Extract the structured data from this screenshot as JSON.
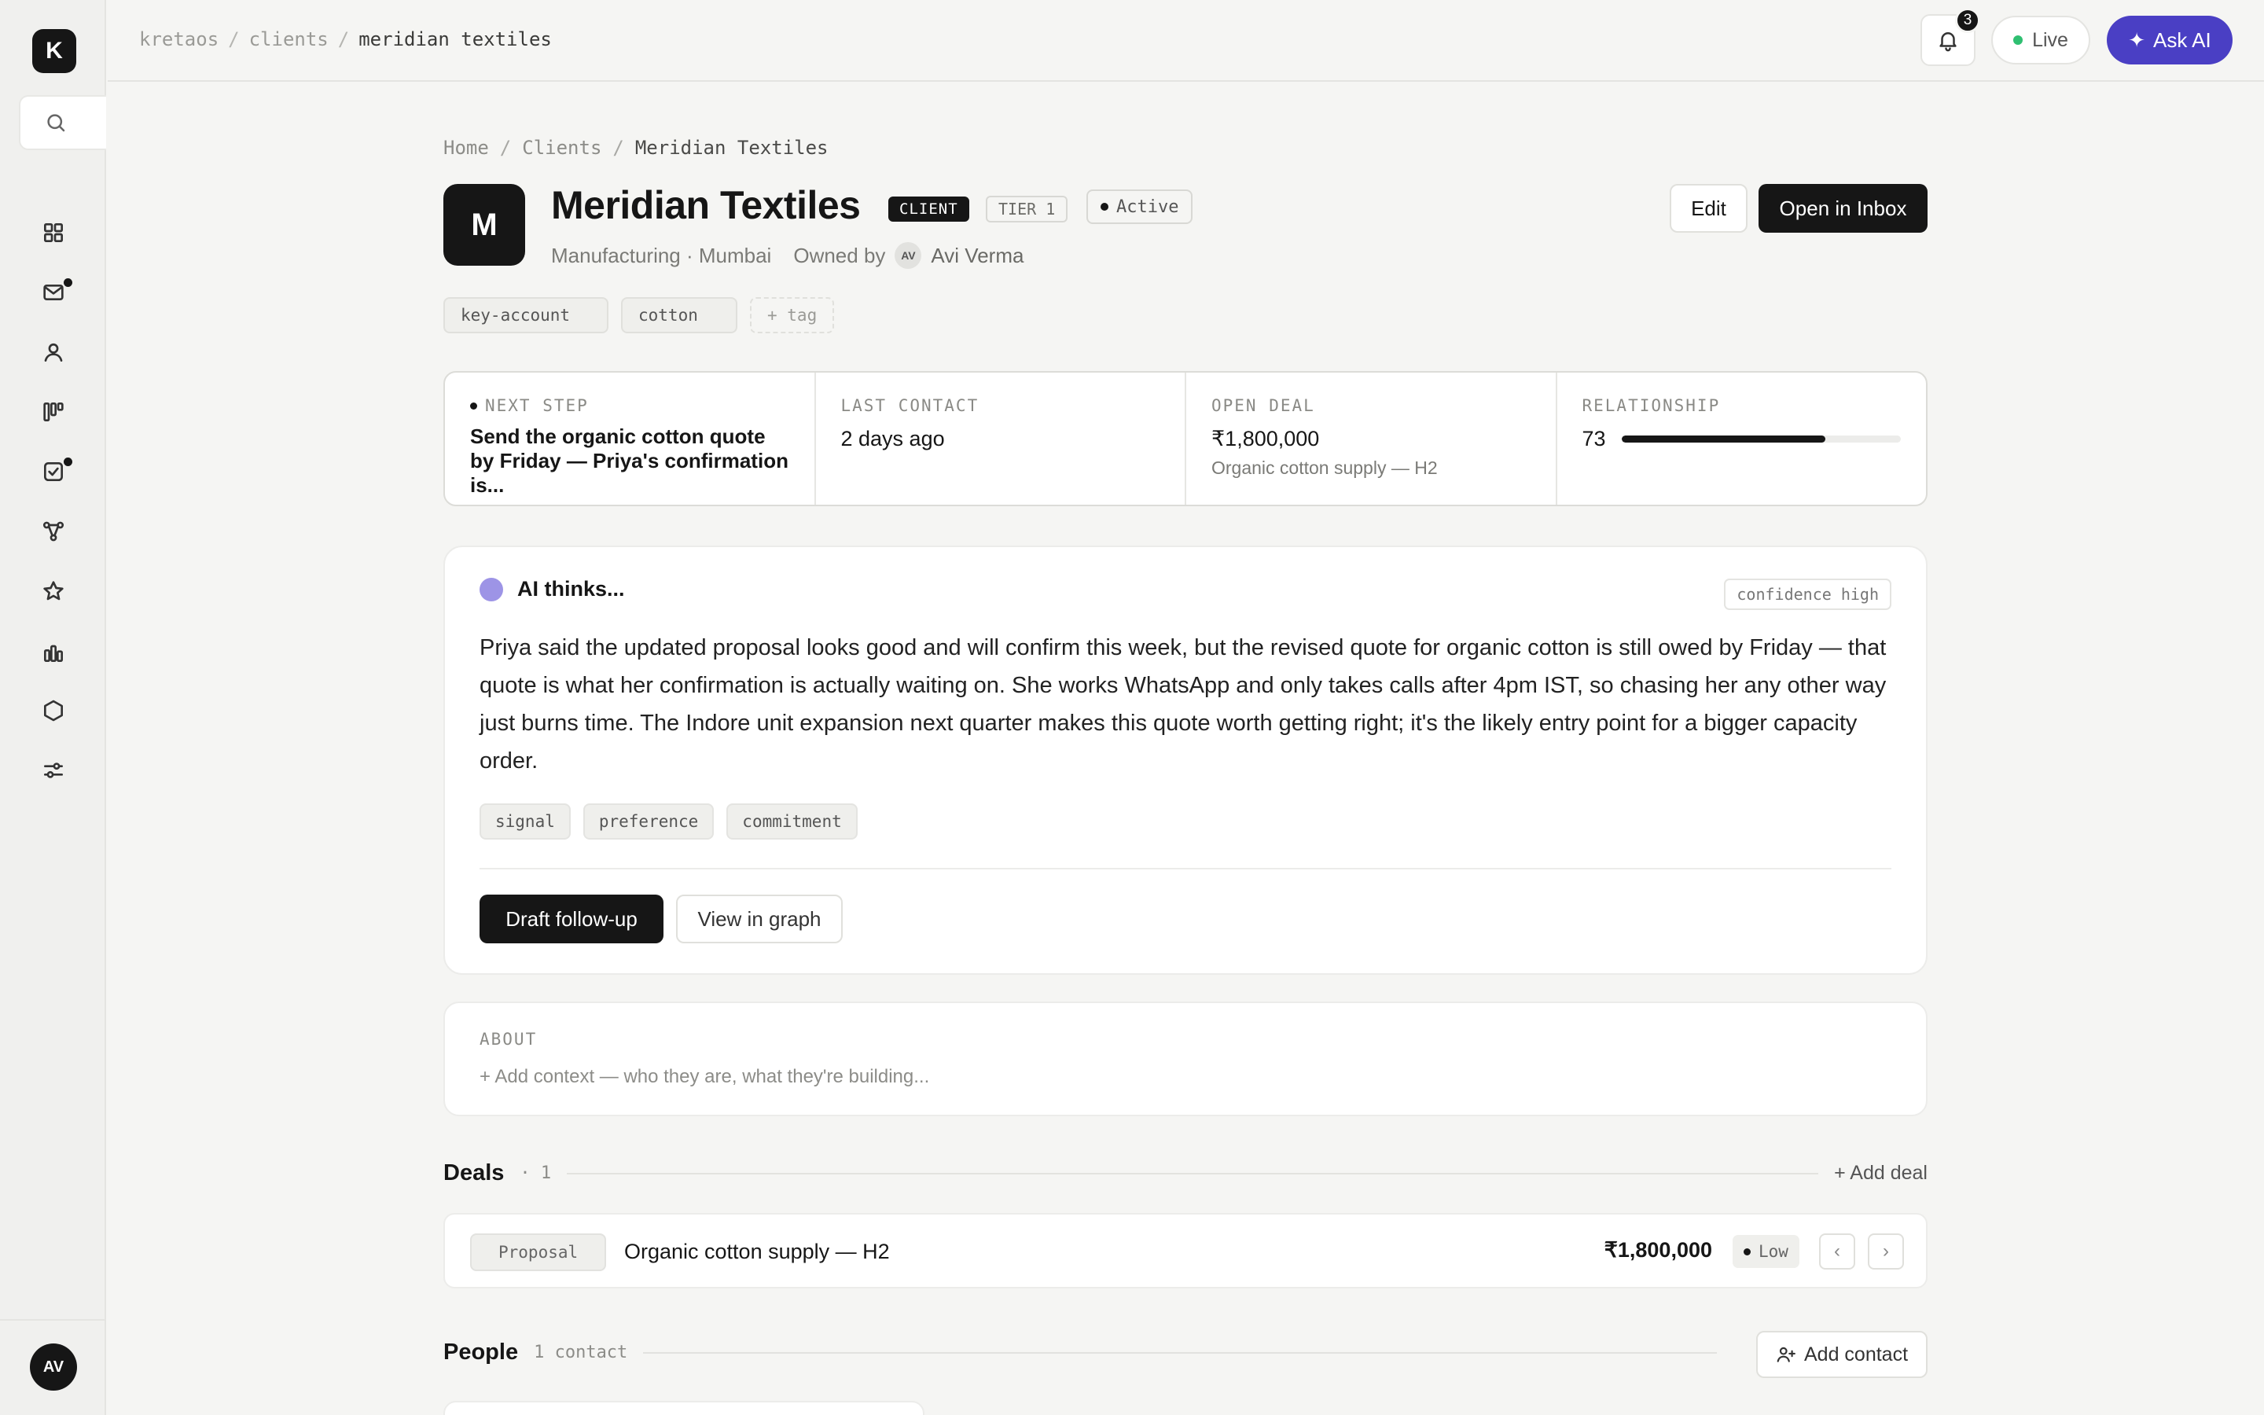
{
  "app": {
    "logo_letter": "K"
  },
  "topbar": {
    "breadcrumb": [
      "kretaos",
      "clients",
      "meridian textiles"
    ],
    "notifications_count": "3",
    "live_label": "Live",
    "ask_ai_label": "Ask AI",
    "colors": {
      "ask_ai": "#4a3fc4",
      "live_dot": "#2fbf71"
    }
  },
  "sidebar": {
    "items": [
      {
        "icon": "grid-icon",
        "name": "dashboard",
        "has_dot": false
      },
      {
        "icon": "mail-icon",
        "name": "inbox",
        "has_dot": true
      },
      {
        "icon": "user-icon",
        "name": "clients",
        "has_dot": false
      },
      {
        "icon": "kanban-icon",
        "name": "pipeline",
        "has_dot": false
      },
      {
        "icon": "checkbox-icon",
        "name": "tasks",
        "has_dot": true
      },
      {
        "icon": "graph-icon",
        "name": "graph",
        "has_dot": false
      },
      {
        "icon": "star-icon",
        "name": "favorites",
        "has_dot": false
      },
      {
        "icon": "bar-chart-icon",
        "name": "analytics",
        "has_dot": false
      },
      {
        "icon": "hexagon-icon",
        "name": "integrations",
        "has_dot": false
      },
      {
        "icon": "sliders-icon",
        "name": "settings",
        "has_dot": false
      }
    ],
    "user_initials": "AV"
  },
  "page": {
    "breadcrumb": {
      "home": "Home",
      "clients": "Clients",
      "current": "Meridian Textiles"
    },
    "client": {
      "initial": "M",
      "name": "Meridian Textiles",
      "type_badge": "CLIENT",
      "tier_badge": "TIER 1",
      "status": "Active",
      "subtitle": "Manufacturing · Mumbai",
      "owned_by_label": "Owned by",
      "owner_initials": "AV",
      "owner_name": "Avi Verma"
    },
    "actions": {
      "edit": "Edit",
      "open_inbox": "Open in Inbox"
    },
    "tags": [
      "key-account",
      "cotton"
    ],
    "add_tag_label": "+ tag"
  },
  "stats": {
    "next_step": {
      "label": "NEXT STEP",
      "value": "Send the organic cotton quote by Friday — Priya's confirmation is..."
    },
    "last_contact": {
      "label": "LAST CONTACT",
      "value": "2 days ago"
    },
    "open_deal": {
      "label": "OPEN DEAL",
      "value": "₹1,800,000",
      "sub": "Organic cotton supply — H2"
    },
    "relationship": {
      "label": "RELATIONSHIP",
      "value": "73",
      "score_fraction": 0.73
    }
  },
  "ai": {
    "title": "AI thinks...",
    "confidence": "confidence high",
    "body": "Priya said the updated proposal looks good and will confirm this week, but the revised quote for organic cotton is still owed by Friday — that quote is what her confirmation is actually waiting on. She works WhatsApp and only takes calls after 4pm IST, so chasing her any other way just burns time. The Indore unit expansion next quarter makes this quote worth getting right; it's the likely entry point for a bigger capacity order.",
    "tags": [
      "signal",
      "preference",
      "commitment"
    ],
    "draft_label": "Draft follow-up",
    "graph_label": "View in graph",
    "orb_color": "#9d94e6"
  },
  "about": {
    "label": "ABOUT",
    "placeholder": "+ Add context — who they are, what they're building..."
  },
  "deals": {
    "title": "Deals",
    "count": "· 1",
    "add_label": "+ Add deal",
    "items": [
      {
        "stage": "Proposal",
        "name": "Organic cotton supply — H2",
        "amount": "₹1,800,000",
        "priority": "Low"
      }
    ],
    "prev_glyph": "‹",
    "next_glyph": "›"
  },
  "people": {
    "title": "People",
    "count": "1 contact",
    "add_label": "Add contact"
  }
}
